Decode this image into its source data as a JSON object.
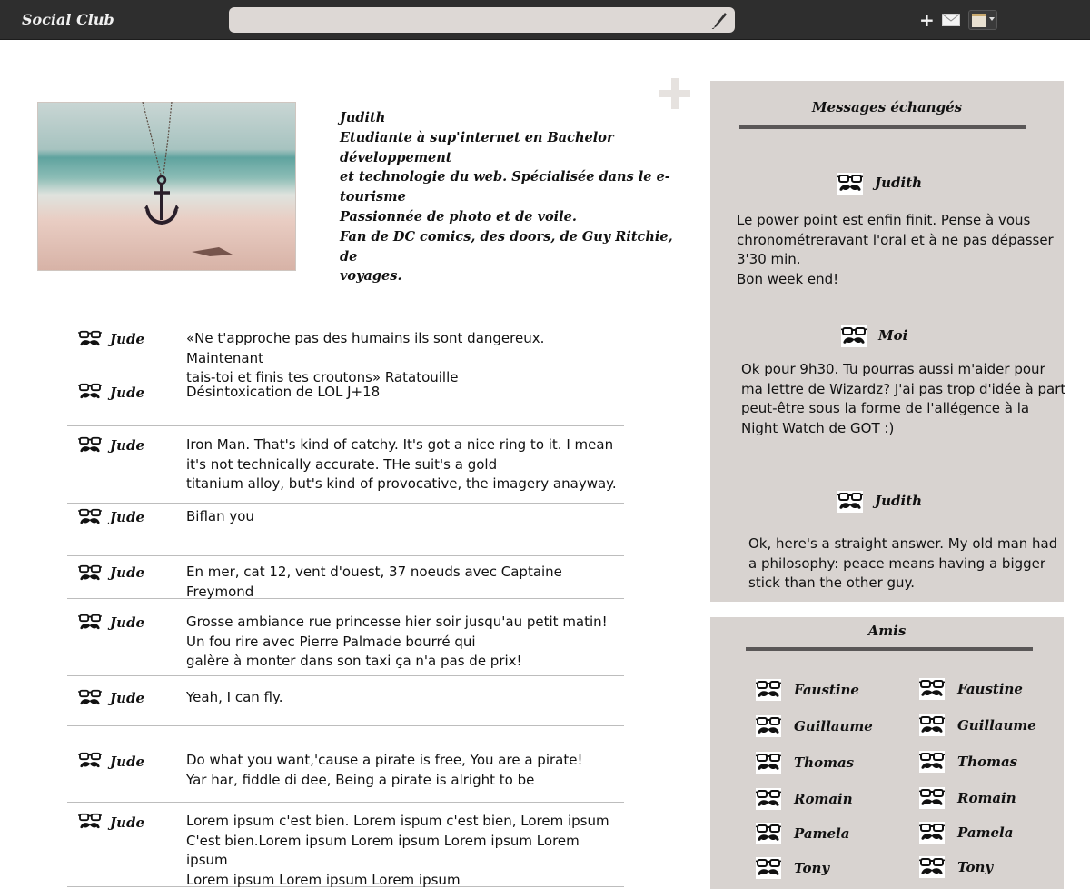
{
  "app": {
    "brand": "Social Club"
  },
  "topbar": {
    "search_value": "",
    "icons": [
      "pen-icon",
      "plus-icon",
      "mail-icon",
      "calendar-icon"
    ]
  },
  "profile": {
    "photo_icon": "anchor-necklace-photo",
    "bio": [
      "Judith",
      "Etudiante à sup'internet en Bachelor développement",
      "et technologie du web.  Spécialisée dans le e-tourisme",
      "Passionnée de photo et de voile.",
      "Fan de DC comics, des doors, de Guy Ritchie, de",
      "voyages."
    ]
  },
  "feed": [
    {
      "author": "Jude",
      "text": "«Ne t'approche pas des humains ils sont dangereux. Maintenant\n tais-toi et finis tes croutons» Ratatouille"
    },
    {
      "author": "Jude",
      "text": "Désintoxication de LOL J+18"
    },
    {
      "author": "Jude",
      "text": "Iron Man. That's kind of catchy. It's got a nice ring to it. I mean\n it's not technically accurate. THe suit's a gold\ntitanium alloy, but's kind of provocative, the imagery anayway."
    },
    {
      "author": "Jude",
      "text": "Biflan you"
    },
    {
      "author": "Jude",
      "text": "En mer, cat 12, vent d'ouest, 37 noeuds avec Captaine Freymond"
    },
    {
      "author": "Jude",
      "text": "Grosse ambiance rue princesse hier soir jusqu'au petit matin!\nUn fou rire avec Pierre Palmade bourré qui\ngalère à monter dans son taxi ça n'a pas de prix!"
    },
    {
      "author": "Jude",
      "text": "Yeah, I can fly."
    },
    {
      "author": "Jude",
      "text": "Do what you want,'cause a pirate is free, You are a pirate!\nYar har, fiddle di dee, Being a pirate is alright to be"
    },
    {
      "author": "Jude",
      "text": "Lorem ipsum c'est bien. Lorem ispum c'est bien, Lorem ipsum\nC'est bien.Lorem ipsum Lorem ipsum Lorem ipsum Lorem ipsum\nLorem ipsum Lorem ipsum Lorem ipsum"
    }
  ],
  "messages": {
    "title": "Messages échangés",
    "items": [
      {
        "name": "Judith",
        "text": "Le power point est enfin finit. Pense à vous\nchronométreravant l'oral et à ne pas dépasser\n3'30 min.\nBon week end!"
      },
      {
        "name": "Moi",
        "text": "Ok pour 9h30. Tu pourras aussi m'aider pour\nma lettre de Wizardz? J'ai pas trop d'idée à part\n peut-être sous la forme de l'allégence à la\nNight Watch de GOT :)"
      },
      {
        "name": "Judith",
        "text": "Ok, here's a straight answer. My old man had\na philosophy: peace means having a bigger\nstick than the other guy."
      }
    ]
  },
  "friends": {
    "title": "Amis",
    "left": [
      "Faustine",
      "Guillaume",
      "Thomas",
      "Romain",
      "Pamela",
      "Tony"
    ],
    "right": [
      "Faustine",
      "Guillaume",
      "Thomas",
      "Romain",
      "Pamela",
      "Tony"
    ]
  },
  "colors": {
    "topbar": "#2e2e2e",
    "panel": "#d8d3d0",
    "rule": "#5a5757",
    "search": "#ddd8d5"
  }
}
